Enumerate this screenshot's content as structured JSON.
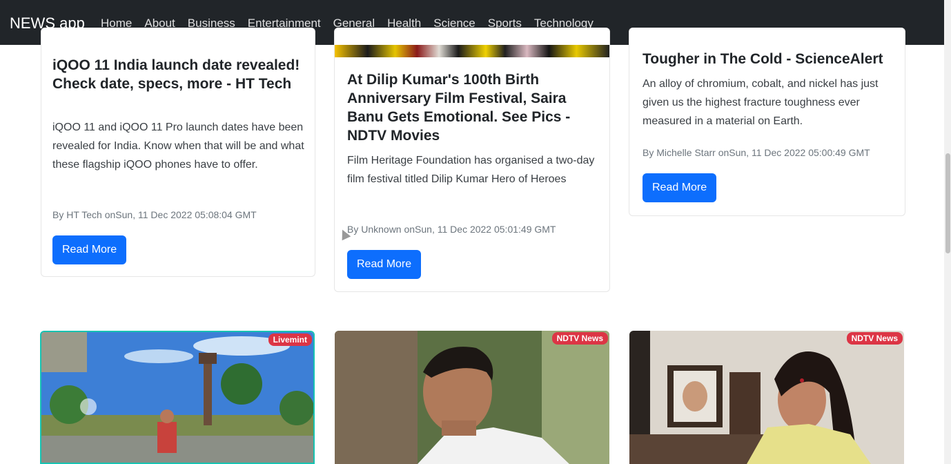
{
  "navbar": {
    "brand": "NEWS app",
    "links": [
      "Home",
      "About",
      "Business",
      "Entertainment",
      "General",
      "Health",
      "Science",
      "Sports",
      "Technology"
    ]
  },
  "cards": [
    {
      "title": "iQOO 11 India launch date revealed! Check date, specs, more - HT Tech",
      "description": "iQOO 11 and iQOO 11 Pro launch dates have been revealed for India. Know when that will be and what these flagship iQOO phones have to offer.",
      "meta": "By HT Tech onSun, 11 Dec 2022 05:08:04 GMT",
      "button": "Read More"
    },
    {
      "title": "At Dilip Kumar's 100th Birth Anniversary Film Festival, Saira Banu Gets Emotional. See Pics - NDTV Movies",
      "description": "Film Heritage Foundation has organised a two-day film festival titled Dilip Kumar Hero of Heroes",
      "meta": "By Unknown onSun, 11 Dec 2022 05:01:49 GMT",
      "button": "Read More"
    },
    {
      "title": "Tougher in The Cold - ScienceAlert",
      "description": "An alloy of chromium, cobalt, and nickel has just given us the highest fracture toughness ever measured in a material on Earth.",
      "meta": "By Michelle Starr onSun, 11 Dec 2022 05:00:49 GMT",
      "button": "Read More"
    }
  ],
  "image_cards": [
    {
      "badge": "Livemint"
    },
    {
      "badge": "NDTV News"
    },
    {
      "badge": "NDTV News"
    }
  ],
  "colors": {
    "navbar": "#212529",
    "primary": "#0d6efd",
    "badge": "#dc3545"
  }
}
